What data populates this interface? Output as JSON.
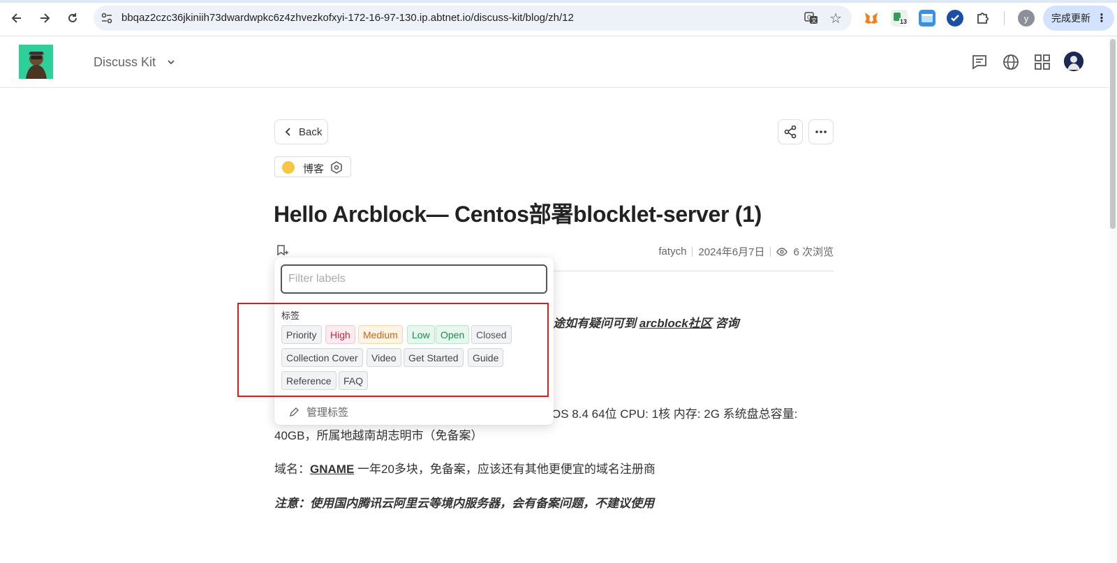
{
  "browser": {
    "url": "bbqaz2czc36jkiniih73dwardwpkc6z4zhvezkofxyi-172-16-97-130.ip.abtnet.io/discuss-kit/blog/zh/12",
    "update_label": "完成更新",
    "profile_initial": "y",
    "ext_badge": "13"
  },
  "app": {
    "brand": "Discuss Kit"
  },
  "post": {
    "back_label": "Back",
    "category": "博客",
    "title": "Hello Arcblock— Centos部署blocklet-server (1)",
    "author": "fatych",
    "date": "2024年6月7日",
    "views": "6 次浏览",
    "line1_prefix": "途如有疑问可到 ",
    "line1_link": "arcblock社区",
    "line1_suffix": " 咨询",
    "line2": "OS 8.4 64位    CPU: 1核    内存: 2G   系统盘总容量:",
    "line3": "40GB，所属地越南胡志明市（免备案）",
    "domain_label": "域名：",
    "domain_link": "GNAME",
    "domain_suffix": "   一年20多块，免备案，应该还有其他更便宜的域名注册商",
    "note": "注意：使用国内腾讯云阿里云等境内服务器，会有备案问题，不建议使用"
  },
  "label_popup": {
    "filter_placeholder": "Filter labels",
    "group_label": "标签",
    "labels": [
      {
        "name": "Priority",
        "color": "#444444",
        "bg": "#f2f3f5",
        "border": "#d6d6d6"
      },
      {
        "name": "High",
        "color": "#c9283d",
        "bg": "#fdecef",
        "border": "#f7c6cf"
      },
      {
        "name": "Medium",
        "color": "#c46a12",
        "bg": "#fdf3e6",
        "border": "#f6d7ad"
      },
      {
        "name": "Low",
        "color": "#1e8a4c",
        "bg": "#e8f7ee",
        "border": "#b8e6c9"
      },
      {
        "name": "Open",
        "color": "#1e8a4c",
        "bg": "#e8f7ee",
        "border": "#b8e6c9"
      },
      {
        "name": "Closed",
        "color": "#555555",
        "bg": "#f2f3f5",
        "border": "#d6d6d6"
      },
      {
        "name": "Collection Cover",
        "color": "#444444",
        "bg": "#f2f3f5",
        "border": "#d6d6d6"
      },
      {
        "name": "Video",
        "color": "#444444",
        "bg": "#f2f3f5",
        "border": "#d6d6d6"
      },
      {
        "name": "Get Started",
        "color": "#444444",
        "bg": "#f2f3f5",
        "border": "#d6d6d6"
      },
      {
        "name": "Guide",
        "color": "#444444",
        "bg": "#f2f3f5",
        "border": "#d6d6d6"
      },
      {
        "name": "Reference",
        "color": "#444444",
        "bg": "#f2f3f5",
        "border": "#d6d6d6"
      },
      {
        "name": "FAQ",
        "color": "#444444",
        "bg": "#f2f3f5",
        "border": "#d6d6d6"
      }
    ],
    "manage_label": "管理标签"
  }
}
